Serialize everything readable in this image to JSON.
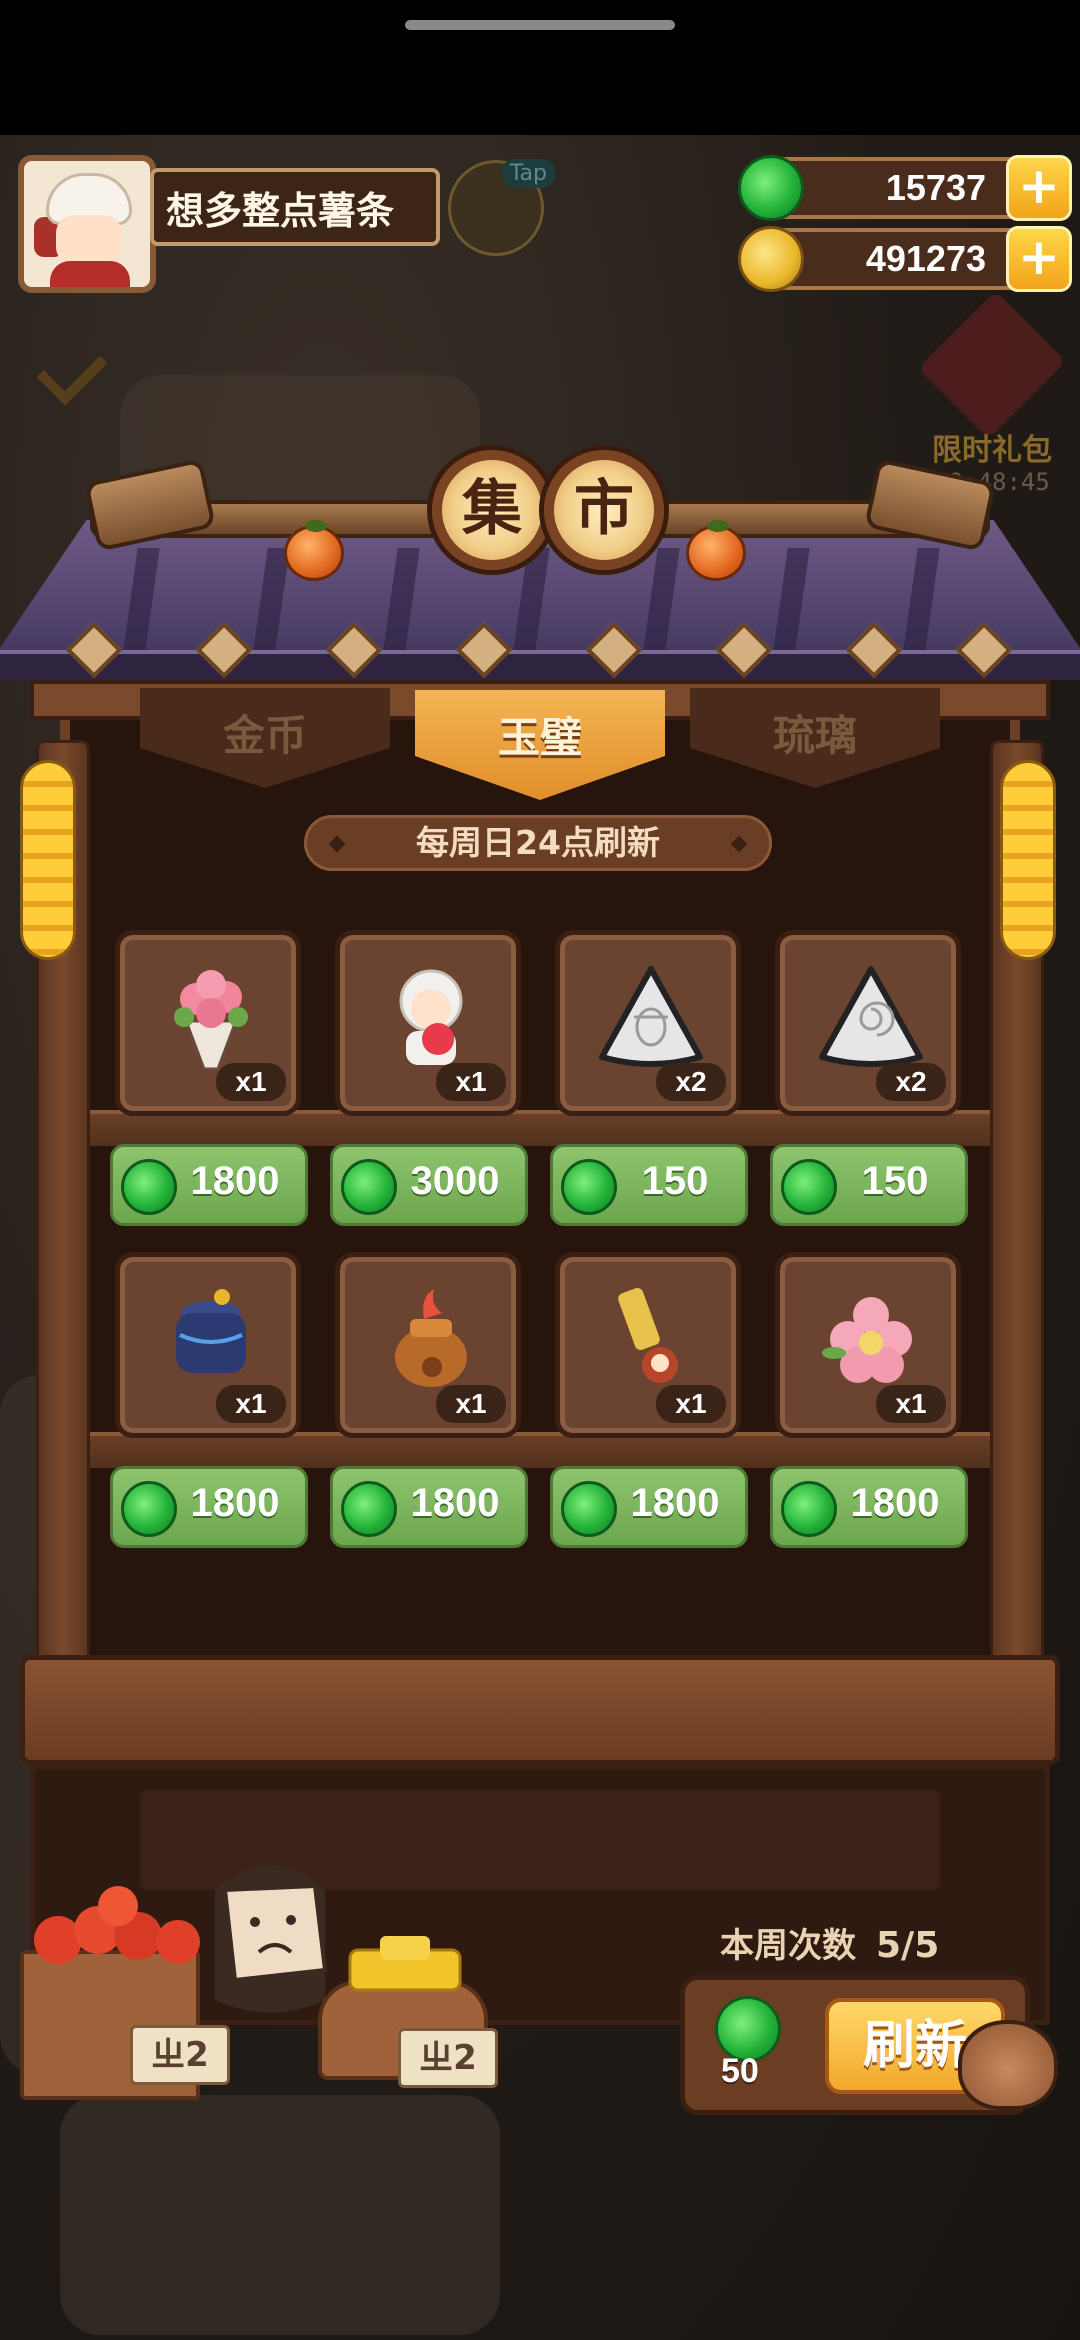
{
  "player": {
    "name": "想多整点薯条"
  },
  "hud": {
    "tap_label": "Tap",
    "jade_amount": "15737",
    "gold_amount": "491273",
    "plus": "+"
  },
  "promo": {
    "title": "限时礼包",
    "timer": "10:48:45"
  },
  "market": {
    "sign_chars": [
      "集",
      "市"
    ],
    "tabs": [
      {
        "label": "金币",
        "active": false
      },
      {
        "label": "玉璧",
        "active": true
      },
      {
        "label": "琉璃",
        "active": false
      }
    ],
    "refresh_notice": "每周日24点刷新",
    "items": [
      {
        "icon": "flower-bouquet-icon",
        "qty": "x1",
        "price": "1800"
      },
      {
        "icon": "chibi-character-icon",
        "qty": "x1",
        "price": "3000"
      },
      {
        "icon": "rice-ball-beetle-icon",
        "qty": "x2",
        "price": "150"
      },
      {
        "icon": "rice-ball-spiral-icon",
        "qty": "x2",
        "price": "150"
      },
      {
        "icon": "dark-pot-icon",
        "qty": "x1",
        "price": "1800"
      },
      {
        "icon": "fire-bag-icon",
        "qty": "x1",
        "price": "1800"
      },
      {
        "icon": "golden-key-icon",
        "qty": "x1",
        "price": "1800"
      },
      {
        "icon": "pink-flower-icon",
        "qty": "x1",
        "price": "1800"
      }
    ],
    "weekly_label": "本周次数",
    "weekly_count": "5/5",
    "refresh_cost": "50",
    "refresh_label": "刷新"
  },
  "counter": {
    "tag_left": "ㄓ2",
    "tag_right": "ㄓ2"
  },
  "colors": {
    "jade": "#24b33a",
    "gold": "#e9b62a",
    "price_bg": "#7db45e",
    "active_tab": "#f0a43c"
  }
}
